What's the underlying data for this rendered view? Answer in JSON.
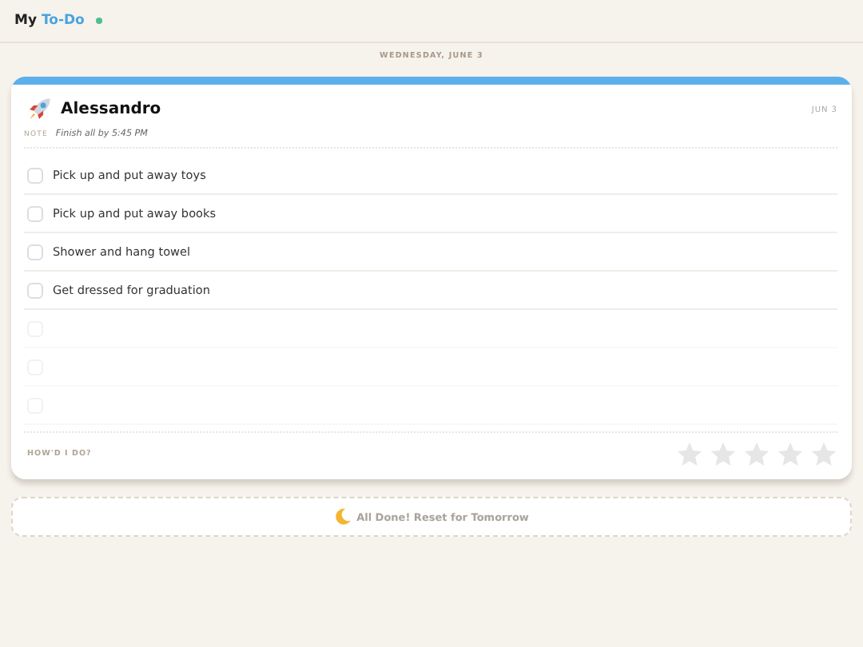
{
  "app": {
    "title_prefix": "My",
    "title_accent": "To-Do",
    "online": true
  },
  "date": "WEDNESDAY, JUNE 3",
  "card": {
    "name": "Alessandro",
    "date": "JUN 3",
    "note_label": "NOTE",
    "note": "Finish all by 5:45 PM",
    "tasks": [
      {
        "kind": "task",
        "label": "Pick up and put away toys",
        "checked": false
      },
      {
        "kind": "task",
        "label": "Pick up and put away books",
        "checked": false
      },
      {
        "kind": "task",
        "label": "Shower and hang towel",
        "checked": false
      },
      {
        "kind": "task",
        "label": "Get dressed for graduation",
        "checked": false
      },
      {
        "kind": "blank",
        "checked": false
      },
      {
        "kind": "blank",
        "checked": false
      },
      {
        "kind": "blank",
        "checked": false
      }
    ],
    "rating_label": "HOW'D I DO?",
    "stars": 0
  },
  "reset_button": "All Done! Reset for Tomorrow"
}
